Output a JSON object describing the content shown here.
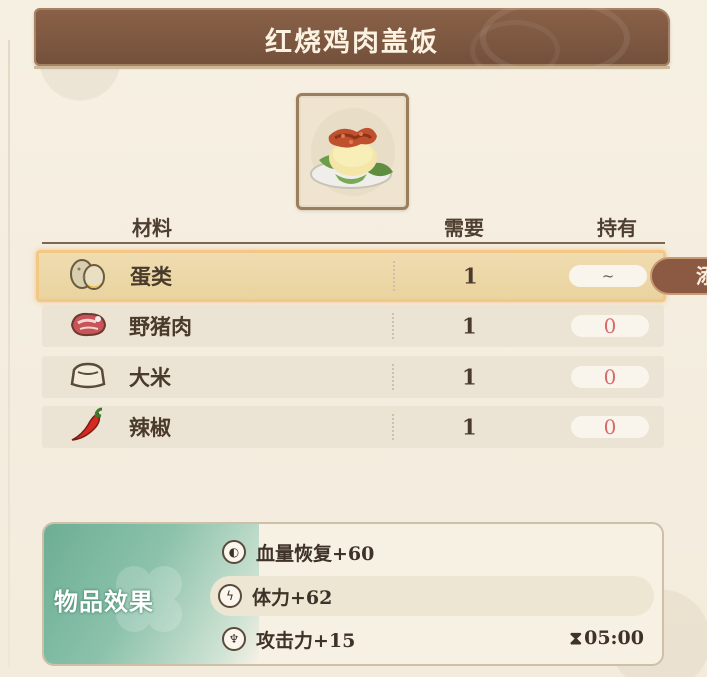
{
  "title": "红烧鸡肉盖饭",
  "dish": {
    "icon": "braised-chicken-rice-icon"
  },
  "columns": {
    "material": "材料",
    "need": "需要",
    "have": "持有"
  },
  "ingredients": [
    {
      "name": "蛋类",
      "icon": "eggs-icon",
      "need": "1",
      "have": "~",
      "selected": true
    },
    {
      "name": "野猪肉",
      "icon": "boar-meat-icon",
      "need": "1",
      "have": "0",
      "selected": false
    },
    {
      "name": "大米",
      "icon": "rice-sack-icon",
      "need": "1",
      "have": "0",
      "selected": false
    },
    {
      "name": "辣椒",
      "icon": "chili-pepper-icon",
      "need": "1",
      "have": "0",
      "selected": false
    }
  ],
  "side_tab": {
    "label": "添"
  },
  "effects": {
    "label": "物品效果",
    "items": [
      {
        "icon": "heal-icon",
        "text": "血量恢复+60"
      },
      {
        "icon": "lightning-icon",
        "text": "体力+62"
      },
      {
        "icon": "attack-icon",
        "text": "攻击力+15"
      }
    ],
    "duration": "05:00",
    "duration_icon": "hourglass-icon"
  }
}
